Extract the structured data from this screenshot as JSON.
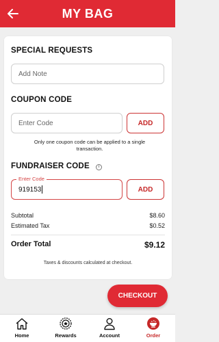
{
  "header": {
    "title": "MY BAG"
  },
  "special_requests": {
    "title": "SPECIAL REQUESTS",
    "placeholder": "Add Note"
  },
  "coupon": {
    "title": "COUPON CODE",
    "placeholder": "Enter Code",
    "add_label": "ADD",
    "note": "Only one coupon code can be applied to a single transaction."
  },
  "fundraiser": {
    "title": "FUNDRAISER CODE",
    "floating_label": "Enter Code",
    "value": "919153",
    "add_label": "ADD"
  },
  "summary": {
    "subtotal_label": "Subtotal",
    "subtotal_value": "$8.60",
    "tax_label": "Estimated Tax",
    "tax_value": "$0.52",
    "total_label": "Order Total",
    "total_value": "$9.12",
    "note": "Taxes & discounts calculated at checkout."
  },
  "checkout": {
    "label": "CHECKOUT"
  },
  "nav": {
    "items": [
      {
        "label": "Home",
        "icon": "home-icon"
      },
      {
        "label": "Rewards",
        "icon": "rewards-badge-icon"
      },
      {
        "label": "Account",
        "icon": "person-icon"
      },
      {
        "label": "Order",
        "icon": "order-bowl-icon"
      }
    ],
    "active": "Order"
  },
  "colors": {
    "brand_red": "#e02a34",
    "accent_red": "#c62828"
  }
}
